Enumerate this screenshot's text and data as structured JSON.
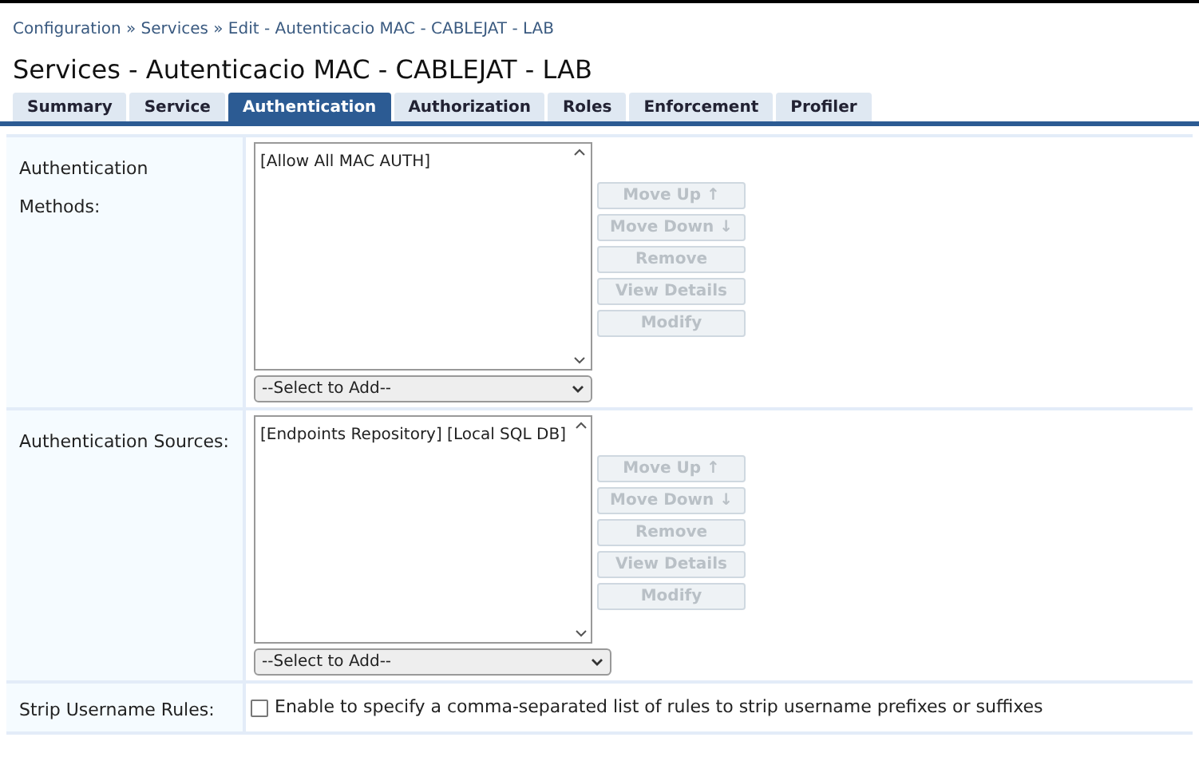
{
  "breadcrumb": "Configuration » Services » Edit - Autenticacio MAC - CABLEJAT - LAB",
  "title": "Services - Autenticacio MAC - CABLEJAT - LAB",
  "tabs": [
    {
      "label": "Summary",
      "selected": false
    },
    {
      "label": "Service",
      "selected": false
    },
    {
      "label": "Authentication",
      "selected": true
    },
    {
      "label": "Authorization",
      "selected": false
    },
    {
      "label": "Roles",
      "selected": false
    },
    {
      "label": "Enforcement",
      "selected": false
    },
    {
      "label": "Profiler",
      "selected": false
    }
  ],
  "sections": [
    {
      "label": "Authentication Methods:",
      "list_items": [
        "[Allow All MAC AUTH]"
      ],
      "select": "--Select to Add--",
      "buttons": [
        {
          "label": "Move Up ↑",
          "disabled": true
        },
        {
          "label": "Move Down ↓",
          "disabled": true
        },
        {
          "label": "Remove",
          "disabled": true
        },
        {
          "label": "View Details",
          "disabled": true
        },
        {
          "label": "Modify",
          "disabled": true
        }
      ]
    },
    {
      "label": "Authentication Sources:",
      "list_items": [
        "[Endpoints Repository] [Local SQL DB]"
      ],
      "select": "--Select to Add--",
      "buttons": [
        {
          "label": "Move Up ↑",
          "disabled": true
        },
        {
          "label": "Move Down ↓",
          "disabled": true
        },
        {
          "label": "Remove",
          "disabled": true
        },
        {
          "label": "View Details",
          "disabled": true
        },
        {
          "label": "Modify",
          "disabled": true
        }
      ]
    }
  ],
  "strip_rules": {
    "label": "Strip Username Rules:",
    "checkbox_label": "Enable to specify a comma-separated list of rules to strip username prefixes or suffixes",
    "checked": false
  }
}
